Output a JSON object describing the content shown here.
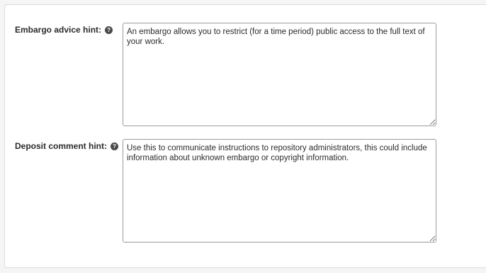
{
  "fields": [
    {
      "label": "Embargo advice hint:",
      "value": "An embargo allows you to restrict (for a time period) public access to the full text of your work."
    },
    {
      "label": "Deposit comment hint:",
      "value": "Use this to communicate instructions to repository administrators, this could include information about unknown embargo or copyright information."
    }
  ],
  "icons": {
    "help": "?"
  }
}
